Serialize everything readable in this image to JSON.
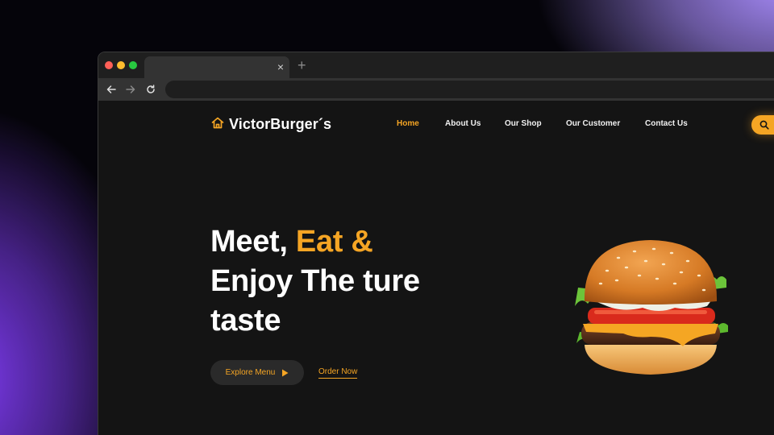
{
  "browser": {
    "tab_title": "",
    "tab_close_glyph": "×",
    "new_tab_glyph": "+",
    "url": ""
  },
  "site": {
    "logo_icon": "home-icon",
    "brand": "VictorBurger´s",
    "nav": [
      {
        "label": "Home",
        "active": true
      },
      {
        "label": "About Us",
        "active": false
      },
      {
        "label": "Our Shop",
        "active": false
      },
      {
        "label": "Our Customer",
        "active": false
      },
      {
        "label": "Contact Us",
        "active": false
      }
    ],
    "search_icon": "search-icon"
  },
  "hero": {
    "line1_plain": "Meet, ",
    "line1_accent": "Eat &",
    "line2": "Enjoy The ture",
    "line3": "taste",
    "explore_label": "Explore Menu",
    "explore_icon": "play-icon",
    "order_label": "Order Now",
    "image": "burger-image"
  },
  "colors": {
    "accent": "#f5a524",
    "page_bg": "#141414",
    "text": "#ffffff"
  }
}
